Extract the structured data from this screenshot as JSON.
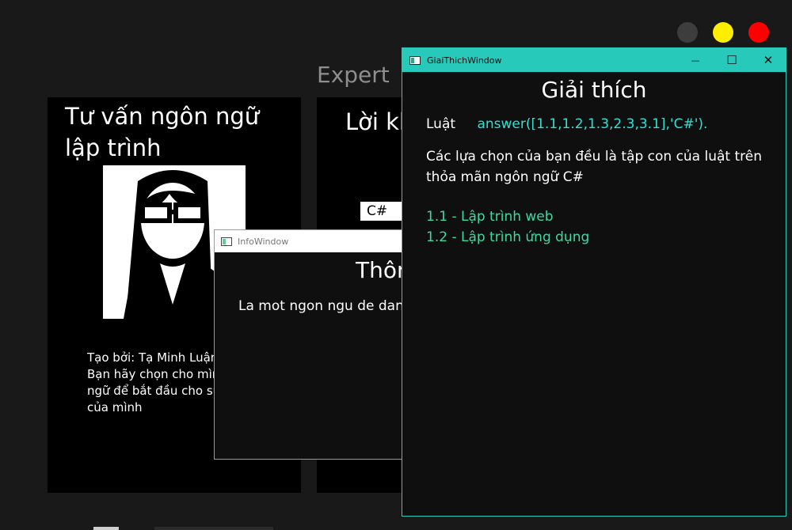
{
  "status_dots": {
    "colors": [
      "#3d3d3d",
      "#ffee00",
      "#ff0000"
    ]
  },
  "main": {
    "title": "Expert"
  },
  "left_panel": {
    "title": "Tư vấn ngôn ngữ lập trình",
    "credits": [
      "Tạo bởi: Tạ Minh Luận",
      "Bạn hãy chọn cho mình",
      "ngữ để bắt đầu cho sự",
      "của mình"
    ]
  },
  "mid_panel": {
    "title": "Lời khuyên",
    "selected_language": "C#"
  },
  "info_window": {
    "title": "InfoWindow",
    "heading": "Thông tin",
    "body": "La mot ngon ngu de dang"
  },
  "explain_window": {
    "title": "GiaiThichWindow",
    "heading": "Giải thích",
    "rule_label": "Luật",
    "rule_value": "answer([1.1,1.2,1.3,2.3,3.1],'C#').",
    "description": "Các lựa chọn của bạn đều là tập con của luật trên thỏa mãn ngôn ngữ C#",
    "items": [
      "1.1 - Lập trình web",
      "1.2 - Lập trình ứng dụng"
    ],
    "controls": {
      "minimize": "—",
      "maximize": "☐",
      "close": "✕"
    }
  }
}
